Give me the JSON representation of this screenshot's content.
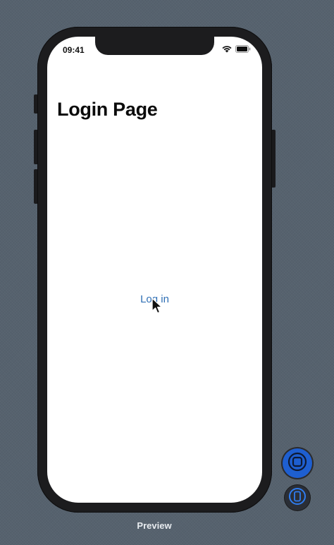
{
  "status_bar": {
    "time": "09:41",
    "icons": [
      "wifi-icon",
      "battery-icon"
    ]
  },
  "screen": {
    "title": "Login Page",
    "login_link": "Log in"
  },
  "preview_controls": {
    "buttons": [
      "live-preview-icon",
      "device-preview-icon"
    ],
    "label": "Preview"
  },
  "colors": {
    "background": "#56626e",
    "phone_frame": "#1c1c1e",
    "link": "#2f6fb5",
    "live_button": "#1e5fd0"
  }
}
